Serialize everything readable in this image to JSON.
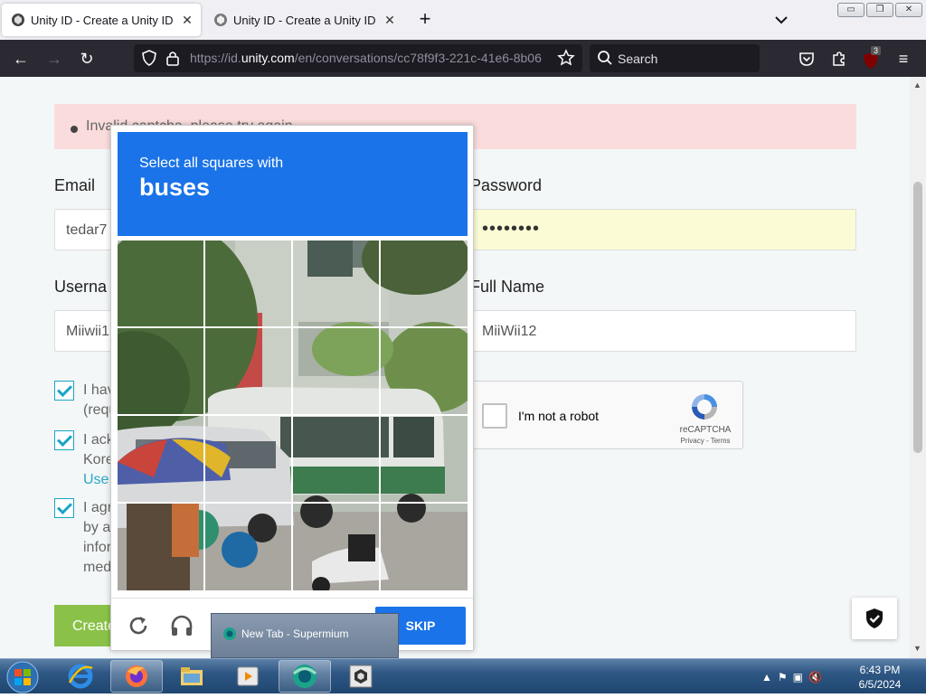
{
  "browser": {
    "tabs": [
      {
        "title": "Unity ID - Create a Unity ID",
        "active": true
      },
      {
        "title": "Unity ID - Create a Unity ID",
        "active": false
      }
    ],
    "url_prefix": "https://id.",
    "url_domain": "unity.com",
    "url_suffix": "/en/conversations/cc78f9f3-221c-41e6-8b06",
    "search_placeholder": "Search",
    "extension_badge": "3"
  },
  "form": {
    "error_message": "Invalid captcha, please try again",
    "email_label": "Email",
    "email_value": "tedar7",
    "password_label": "Password",
    "password_value": "••••••••",
    "username_label": "Userna",
    "username_value": "Miiwii1",
    "fullname_label": "Full Name",
    "fullname_value": "MiiWii12",
    "checkbox1_line1": "I hav",
    "checkbox1_line2": "(requ",
    "checkbox2_line1": "I ack",
    "checkbox2_line2": "Kore",
    "checkbox2_line3": "Use",
    "checkbox3_line1": "I agr",
    "checkbox3_line2": "by a",
    "checkbox3_line3": "infor",
    "checkbox3_line4": "med",
    "create_button": "Create"
  },
  "recaptcha": {
    "label": "I'm not a robot",
    "brand": "reCAPTCHA",
    "terms": "Privacy - Terms"
  },
  "captcha_challenge": {
    "instruction": "Select all squares with",
    "target": "buses",
    "skip_label": "SKIP"
  },
  "taskbar": {
    "tooltip": "New Tab - Supermium",
    "time": "6:43 PM",
    "date": "6/5/2024"
  }
}
